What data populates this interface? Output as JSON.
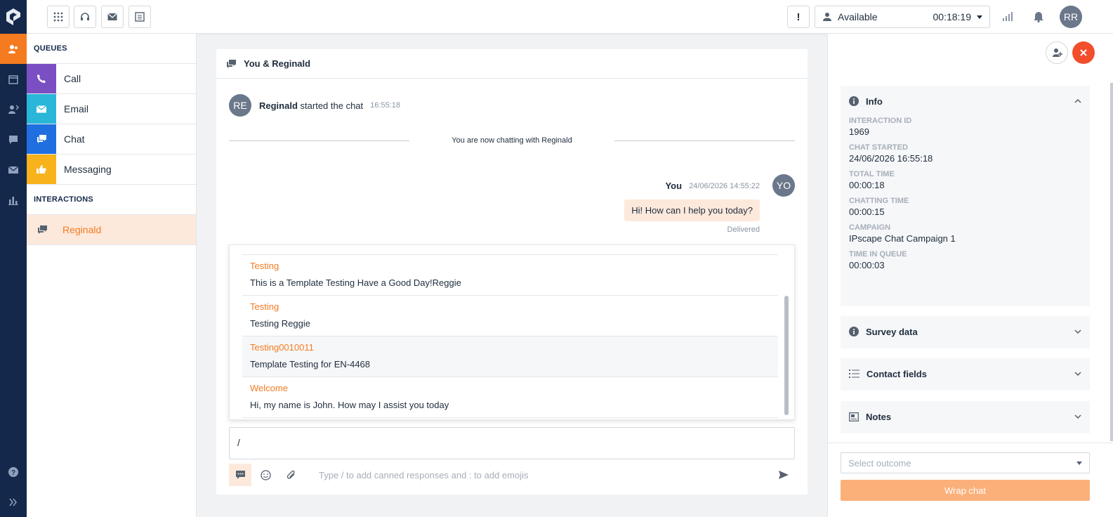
{
  "topbar": {
    "status": "Available",
    "timer": "00:18:19",
    "alert": "!",
    "user_initials": "RR"
  },
  "queues": {
    "section_title": "QUEUES",
    "items": [
      {
        "label": "Call",
        "color": "#7b4fc4"
      },
      {
        "label": "Email",
        "color": "#29b6d8"
      },
      {
        "label": "Chat",
        "color": "#1f6fe0"
      },
      {
        "label": "Messaging",
        "color": "#f8b21b"
      }
    ],
    "interactions_title": "INTERACTIONS",
    "interaction": "Reginald"
  },
  "chat": {
    "title": "You & Reginald",
    "system": {
      "initials": "RE",
      "name": "Reginald",
      "text": "started the chat",
      "time": "16:55:18"
    },
    "divider": "You are now chatting with Reginald",
    "you": {
      "name": "You",
      "time": "24/06/2026 14:55:22",
      "initials": "YO",
      "message": "Hi! How can I help you today?",
      "status": "Delivered"
    },
    "canned": [
      {
        "name": "Testing",
        "body": "This is a Template Testing Have a Good Day!Reggie"
      },
      {
        "name": "Testing",
        "body": "Testing Reggie"
      },
      {
        "name": "Testing0010011",
        "body": "Template Testing for EN-4468"
      },
      {
        "name": "Welcome",
        "body": "Hi, my name is John. How may I assist you today"
      }
    ],
    "composer_value": "/",
    "placeholder": "Type / to add canned responses and : to add emojis"
  },
  "info": {
    "title": "Info",
    "fields": [
      {
        "key": "INTERACTION ID",
        "value": "1969"
      },
      {
        "key": "CHAT STARTED",
        "value": "24/06/2026 16:55:18"
      },
      {
        "key": "TOTAL TIME",
        "value": "00:00:18"
      },
      {
        "key": "CHATTING TIME",
        "value": "00:00:15"
      },
      {
        "key": "CAMPAIGN",
        "value": "IPscape Chat Campaign 1"
      },
      {
        "key": "TIME IN QUEUE",
        "value": "00:00:03"
      }
    ],
    "sections": [
      "Survey data",
      "Contact fields",
      "Notes"
    ],
    "outcome_placeholder": "Select outcome",
    "wrap_label": "Wrap chat"
  }
}
